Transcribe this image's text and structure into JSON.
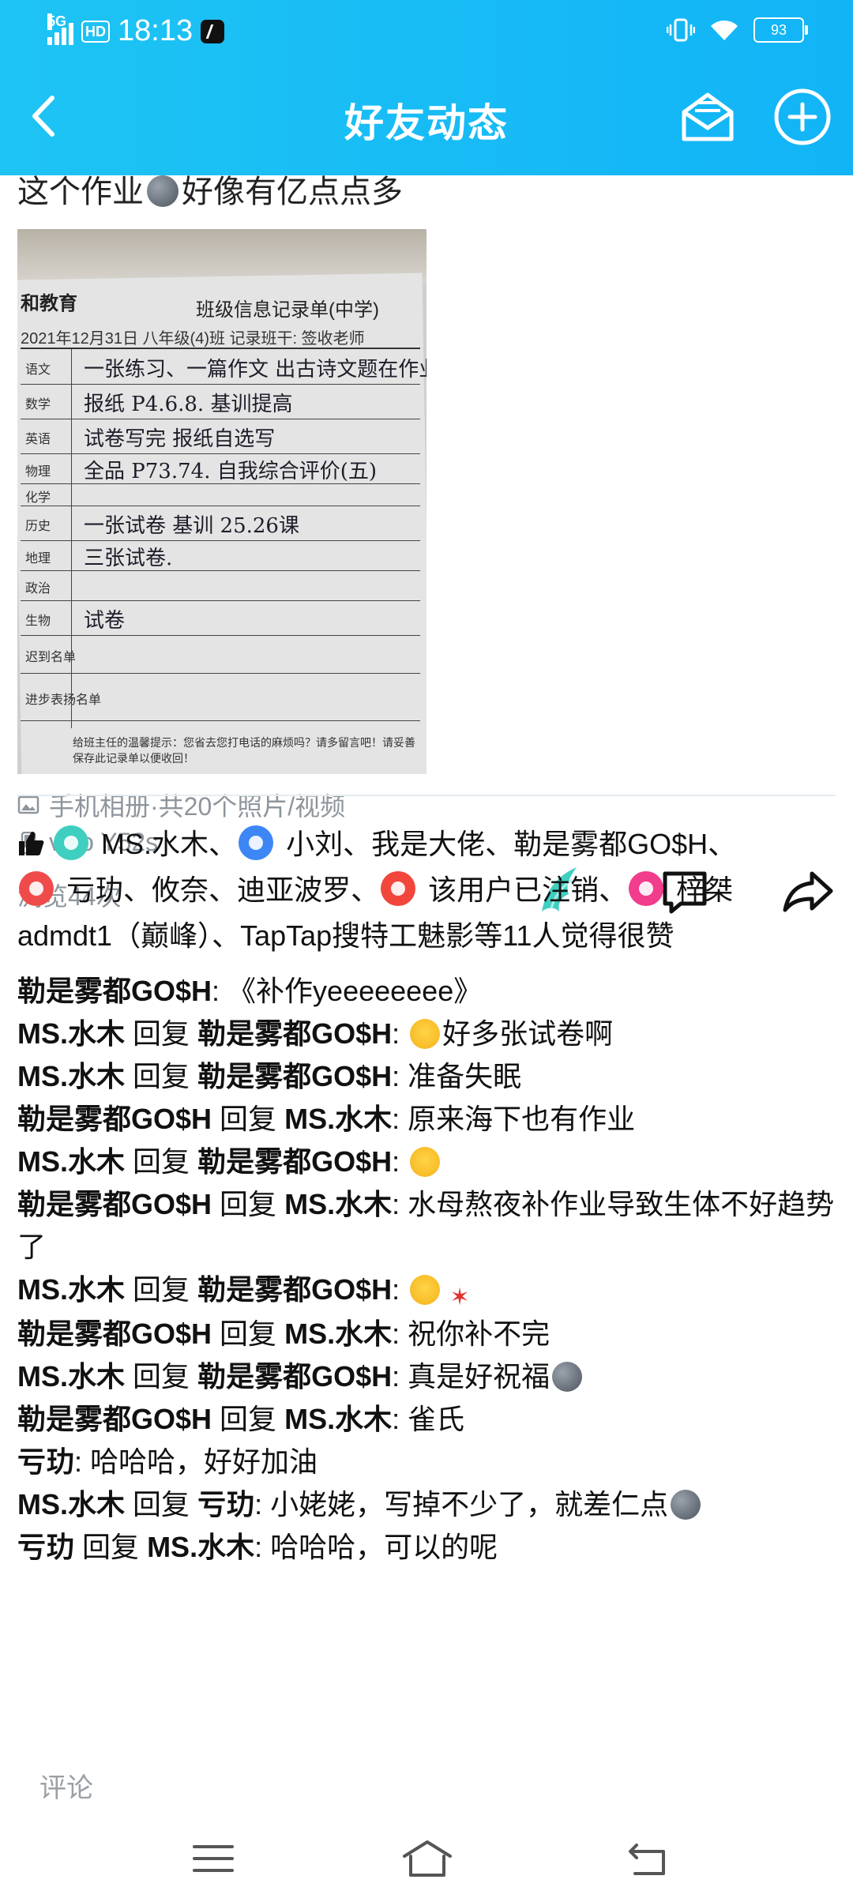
{
  "status_bar": {
    "network": "5G",
    "hd": "HD",
    "time": "18:13",
    "battery": "93"
  },
  "header": {
    "title": "好友动态"
  },
  "post": {
    "text_before": "这个作业",
    "text_after": "好像有亿点点多",
    "sheet": {
      "org": "和教育",
      "title": "班级信息记录单(中学)",
      "date": "2021年12月31日  八年级(4)班  记录班干:        签收老师",
      "rows": [
        {
          "subject": "语文",
          "note": "一张练习、一篇作文  出古诗文题在作业本上"
        },
        {
          "subject": "数学",
          "note": "报纸 P4.6.8. 基训提高"
        },
        {
          "subject": "英语",
          "note": "试卷写完  报纸自选写"
        },
        {
          "subject": "物理",
          "note": "全品 P73.74. 自我综合评价(五)"
        },
        {
          "subject": "化学",
          "note": ""
        },
        {
          "subject": "历史",
          "note": "一张试卷  基训 25.26课"
        },
        {
          "subject": "地理",
          "note": "三张试卷."
        },
        {
          "subject": "政治",
          "note": ""
        },
        {
          "subject": "生物",
          "note": "试卷"
        },
        {
          "subject": "迟到名单",
          "note": ""
        },
        {
          "subject": "进步表扬名单",
          "note": ""
        }
      ],
      "footer": "给班主任的温馨提示：您省去您打电话的麻烦吗？请多留言吧！请妥善保存此记录单以便收回！"
    },
    "album": "手机相册·共20个照片/视频",
    "device": "vivo Y52s",
    "views": "浏览44次"
  },
  "likes": {
    "names": [
      "MS.水木",
      "小刘",
      "我是大佬",
      "勒是雾都GO$H",
      "亏玏",
      "攸奈",
      "迪亚波罗",
      "该用户已注销",
      "梓桀",
      "admdt1（巅峰）",
      "TapTap搜特工魅影"
    ],
    "suffix": "等11人觉得很赞"
  },
  "comments": [
    {
      "from": "勒是雾都GO$H",
      "to": "",
      "text": "《补作yeeeeeeee》",
      "emoji": ""
    },
    {
      "from": "MS.水木",
      "to": "勒是雾都GO$H",
      "text": "好多张试卷啊",
      "emoji": "cry-face"
    },
    {
      "from": "MS.水木",
      "to": "勒是雾都GO$H",
      "text": "准备失眠",
      "emoji": ""
    },
    {
      "from": "勒是雾都GO$H",
      "to": "MS.水木",
      "text": "原来海下也有作业",
      "emoji": ""
    },
    {
      "from": "MS.水木",
      "to": "勒是雾都GO$H",
      "text": "",
      "emoji": "cry-face"
    },
    {
      "from": "勒是雾都GO$H",
      "to": "MS.水木",
      "text": "水母熬夜补作业导致生体不好趋势了",
      "emoji": ""
    },
    {
      "from": "MS.水木",
      "to": "勒是雾都GO$H",
      "text": "",
      "emoji": "smile-anger"
    },
    {
      "from": "勒是雾都GO$H",
      "to": "MS.水木",
      "text": "祝你补不完",
      "emoji": ""
    },
    {
      "from": "MS.水木",
      "to": "勒是雾都GO$H",
      "text": "真是好祝福",
      "emoji": "moon-face"
    },
    {
      "from": "勒是雾都GO$H",
      "to": "MS.水木",
      "text": "雀氏",
      "emoji": ""
    },
    {
      "from": "亏玏",
      "to": "",
      "text": "哈哈哈，好好加油",
      "emoji": ""
    },
    {
      "from": "MS.水木",
      "to": "亏玏",
      "text": "小姥姥，写掉不少了，就差仁点",
      "emoji": "moon-face"
    },
    {
      "from": "亏玏",
      "to": "MS.水木",
      "text": "哈哈哈，可以的呢",
      "emoji": ""
    }
  ],
  "reply_word": "回复",
  "comment_placeholder": "评论",
  "icons": {
    "back": "chevron-left-icon",
    "mail": "mail-icon",
    "add": "plus-circle-icon",
    "like": "wing-like-icon",
    "comment": "comment-icon",
    "share": "share-icon",
    "album": "image-icon",
    "device": "phone-icon",
    "thumb": "thumbs-up-icon"
  },
  "colors": {
    "header": "#14b9f5",
    "muted": "#8e959c",
    "like_icon": "#3fcfc0"
  }
}
